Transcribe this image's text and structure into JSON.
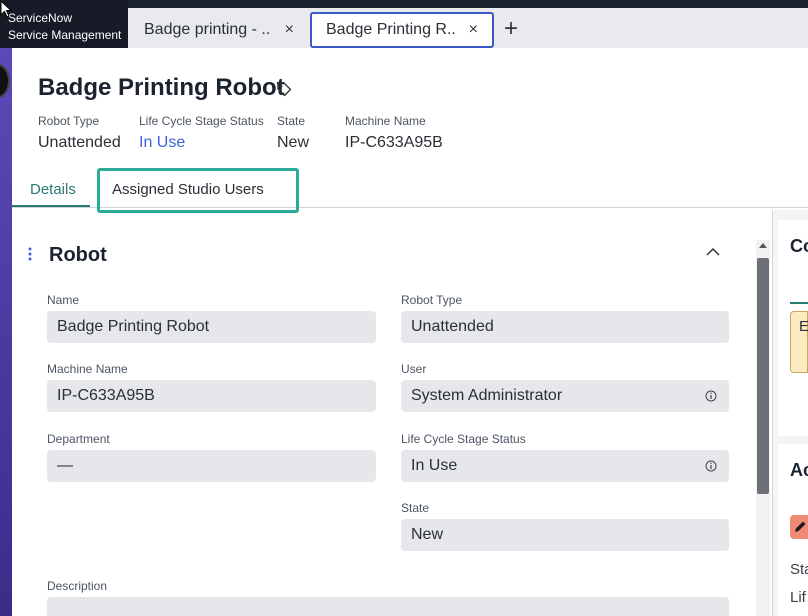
{
  "app": {
    "brand_line1": "ServiceNow",
    "brand_line2": "Service Management"
  },
  "tabs": [
    {
      "label": "Badge printing - ...",
      "close": "×"
    },
    {
      "label": "Badge Printing R...",
      "close": "×"
    }
  ],
  "add_tab_label": "+",
  "record": {
    "title": "Badge Printing Robot",
    "meta": [
      {
        "label": "Robot Type",
        "value": "Unattended"
      },
      {
        "label": "Life Cycle Stage Status",
        "value": "In Use"
      },
      {
        "label": "State",
        "value": "New"
      },
      {
        "label": "Machine Name",
        "value": "IP-C633A95B"
      }
    ]
  },
  "form_tabs": {
    "details": "Details",
    "assigned": "Assigned Studio Users"
  },
  "section": {
    "title": "Robot"
  },
  "fields": {
    "name": {
      "label": "Name",
      "value": "Badge Printing Robot"
    },
    "robot_type": {
      "label": "Robot Type",
      "value": "Unattended"
    },
    "machine_name": {
      "label": "Machine Name",
      "value": "IP-C633A95B"
    },
    "user": {
      "label": "User",
      "value": "System Administrator"
    },
    "department": {
      "label": "Department",
      "value": "—"
    },
    "lifecycle": {
      "label": "Life Cycle Stage Status",
      "value": "In Use"
    },
    "state": {
      "label": "State",
      "value": "New"
    },
    "description": {
      "label": "Description"
    }
  },
  "sidebar": {
    "card1_title": "Co",
    "notice_text": "E",
    "card2_title": "Ac",
    "row1": "Sta",
    "row2": "Lif"
  },
  "colors": {
    "accent": "#2a7a74",
    "link": "#3e63dd",
    "highlight": "#2aab96",
    "active_tab_border": "#3d59c8"
  }
}
